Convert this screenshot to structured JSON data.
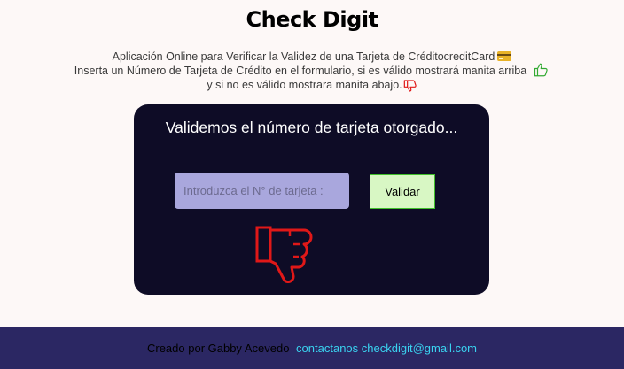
{
  "header": {
    "title": "Check Digit"
  },
  "description": {
    "line1": "Aplicación Online para Verificar la Validez de una Tarjeta de CréditocreditCard",
    "line2": "Inserta un Número de Tarjeta de Crédito en el formulario, si es válido mostrará manita arriba",
    "line3": "y si no es válido mostrara manita abajo."
  },
  "panel": {
    "heading": "Validemos el número de tarjeta otorgado...",
    "input_placeholder": "Introduzca el N° de tarjeta :",
    "input_value": "",
    "button_label": "Validar",
    "result": "invalid"
  },
  "footer": {
    "credit": "Creado por Gabby Acevedo",
    "contact": "contactanos checkdigit@gmail.com"
  },
  "colors": {
    "panel_bg": "#0e0c26",
    "footer_bg": "#2b2763",
    "thumbs_up": "#33aa33",
    "thumbs_down": "#e01818",
    "link": "#3ad3f0"
  },
  "icons": [
    "credit-card-icon",
    "thumbs-up-icon",
    "thumbs-down-icon"
  ]
}
